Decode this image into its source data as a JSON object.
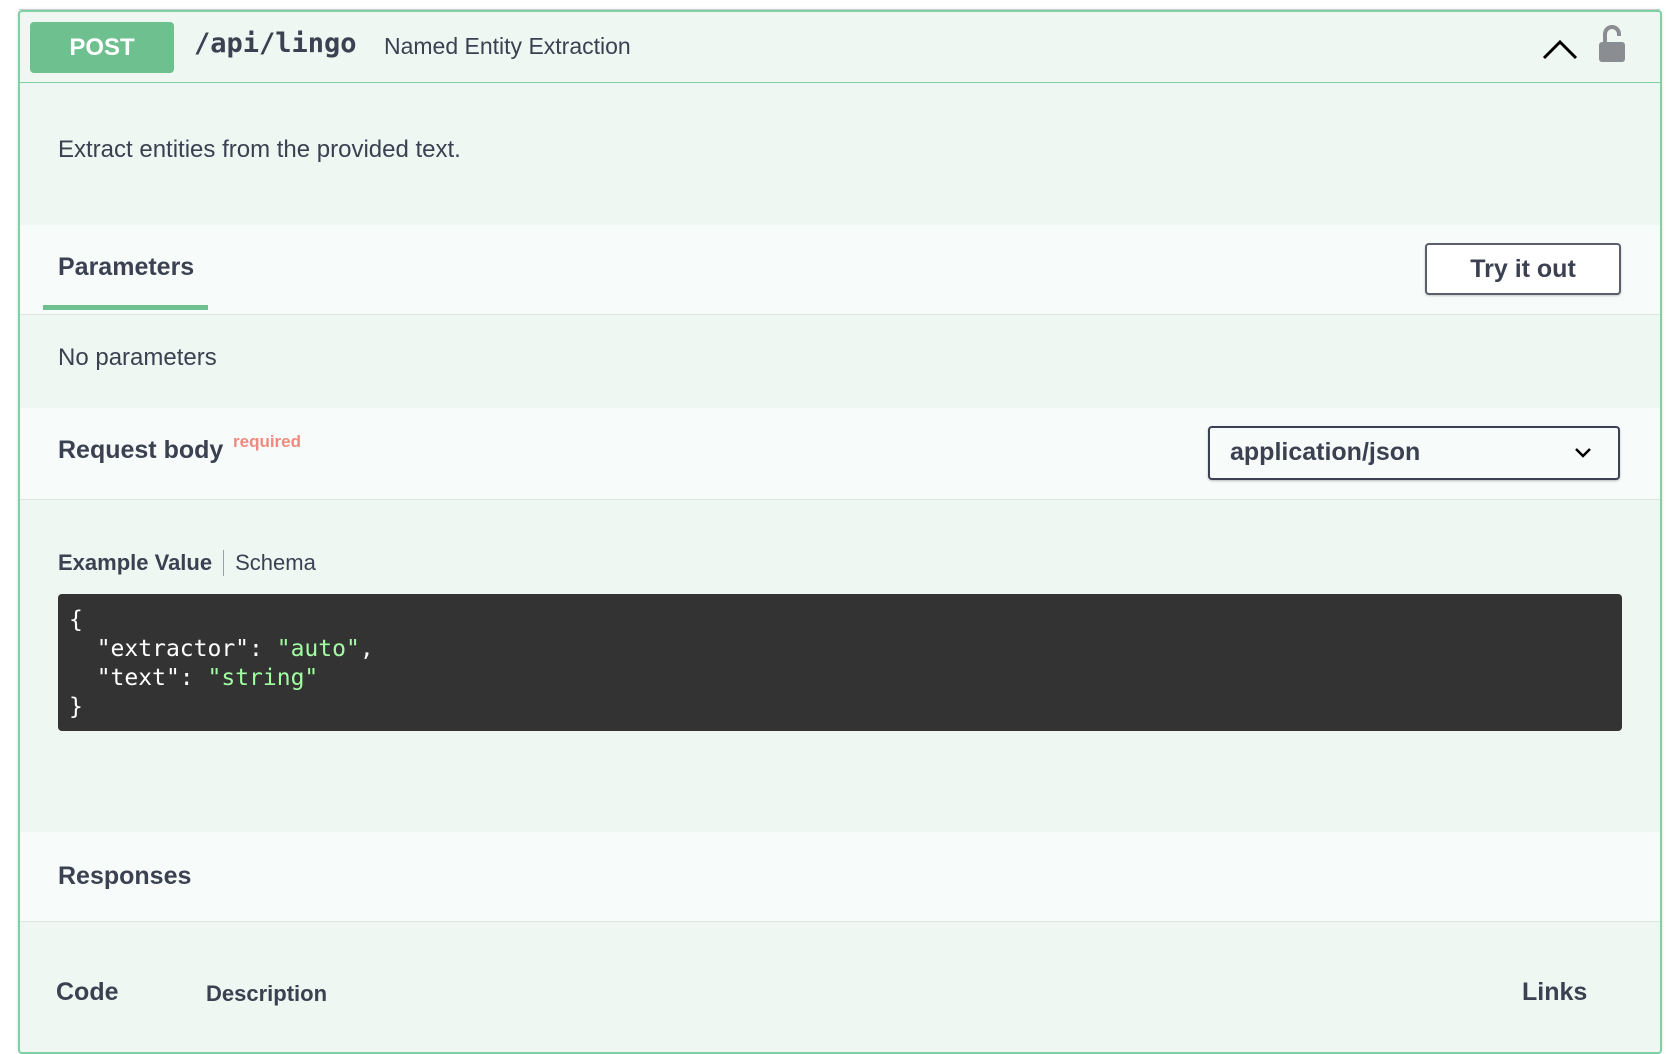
{
  "operation": {
    "method": "POST",
    "path": "/api/lingo",
    "summary": "Named Entity Extraction",
    "description": "Extract entities from the provided text."
  },
  "parameters": {
    "tab_label": "Parameters",
    "try_button_label": "Try it out",
    "empty_text": "No parameters"
  },
  "request_body": {
    "title": "Request body",
    "required_label": "required",
    "content_type": "application/json",
    "tabs": [
      "Example Value",
      "Schema"
    ],
    "example": {
      "open": "{",
      "line1_key": "\"extractor\"",
      "line1_sep": ": ",
      "line1_val": "\"auto\"",
      "line1_comma": ",",
      "line2_key": "\"text\"",
      "line2_sep": ": ",
      "line2_val": "\"string\"",
      "close": "}"
    }
  },
  "responses": {
    "title": "Responses",
    "columns": [
      "Code",
      "Description",
      "Links"
    ]
  },
  "colors": {
    "post_green": "#6fc08f",
    "opblock_bg": "#eef7f2",
    "required_red": "#f08a7f",
    "code_bg": "#333333",
    "string_green": "#a2fca2"
  },
  "icons": {
    "collapse": "chevron-up-icon",
    "auth": "unlocked-icon",
    "select_caret": "chevron-down-icon"
  }
}
